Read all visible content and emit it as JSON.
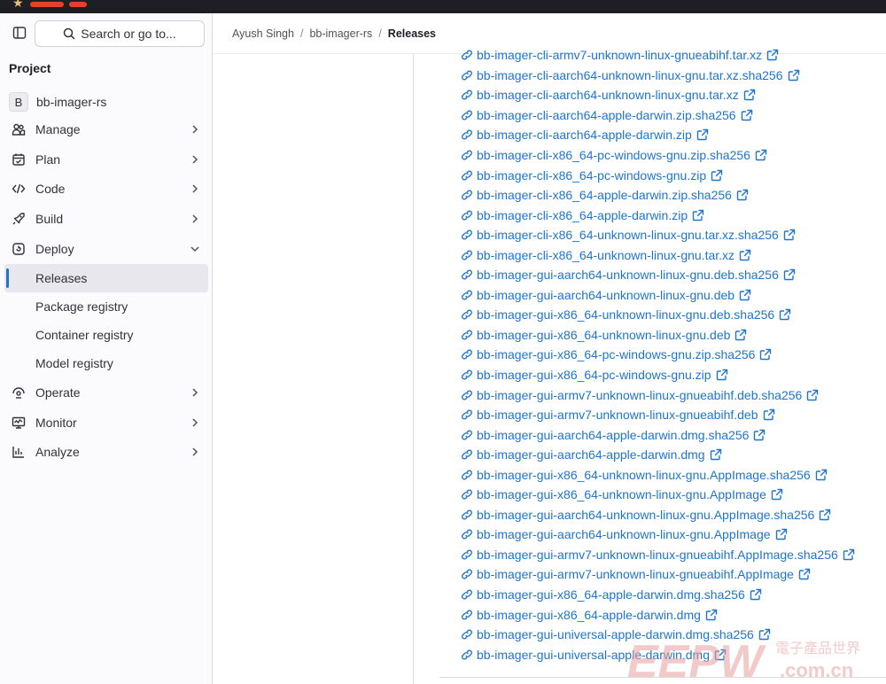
{
  "search": {
    "label": "Search or go to..."
  },
  "sidebar": {
    "section_title": "Project",
    "project": {
      "avatar_letter": "B",
      "name": "bb-imager-rs"
    },
    "items": [
      {
        "label": "Manage",
        "icon": "users-icon"
      },
      {
        "label": "Plan",
        "icon": "calendar-icon"
      },
      {
        "label": "Code",
        "icon": "code-icon"
      },
      {
        "label": "Build",
        "icon": "rocket-icon"
      },
      {
        "label": "Deploy",
        "icon": "deploy-icon"
      }
    ],
    "deploy_sub": [
      {
        "label": "Releases",
        "active": true
      },
      {
        "label": "Package registry"
      },
      {
        "label": "Container registry"
      },
      {
        "label": "Model registry"
      }
    ],
    "items_after": [
      {
        "label": "Operate",
        "icon": "operate-icon"
      },
      {
        "label": "Monitor",
        "icon": "monitor-icon"
      },
      {
        "label": "Analyze",
        "icon": "chart-icon"
      }
    ]
  },
  "breadcrumb": {
    "user": "Ayush Singh",
    "sep1": "/",
    "project": "bb-imager-rs",
    "sep2": "/",
    "current": "Releases"
  },
  "assets": [
    "bb-imager-cli-armv7-unknown-linux-gnueabihf.tar.xz",
    "bb-imager-cli-aarch64-unknown-linux-gnu.tar.xz.sha256",
    "bb-imager-cli-aarch64-unknown-linux-gnu.tar.xz",
    "bb-imager-cli-aarch64-apple-darwin.zip.sha256",
    "bb-imager-cli-aarch64-apple-darwin.zip",
    "bb-imager-cli-x86_64-pc-windows-gnu.zip.sha256",
    "bb-imager-cli-x86_64-pc-windows-gnu.zip",
    "bb-imager-cli-x86_64-apple-darwin.zip.sha256",
    "bb-imager-cli-x86_64-apple-darwin.zip",
    "bb-imager-cli-x86_64-unknown-linux-gnu.tar.xz.sha256",
    "bb-imager-cli-x86_64-unknown-linux-gnu.tar.xz",
    "bb-imager-gui-aarch64-unknown-linux-gnu.deb.sha256",
    "bb-imager-gui-aarch64-unknown-linux-gnu.deb",
    "bb-imager-gui-x86_64-unknown-linux-gnu.deb.sha256",
    "bb-imager-gui-x86_64-unknown-linux-gnu.deb",
    "bb-imager-gui-x86_64-pc-windows-gnu.zip.sha256",
    "bb-imager-gui-x86_64-pc-windows-gnu.zip",
    "bb-imager-gui-armv7-unknown-linux-gnueabihf.deb.sha256",
    "bb-imager-gui-armv7-unknown-linux-gnueabihf.deb",
    "bb-imager-gui-aarch64-apple-darwin.dmg.sha256",
    "bb-imager-gui-aarch64-apple-darwin.dmg",
    "bb-imager-gui-x86_64-unknown-linux-gnu.AppImage.sha256",
    "bb-imager-gui-x86_64-unknown-linux-gnu.AppImage",
    "bb-imager-gui-aarch64-unknown-linux-gnu.AppImage.sha256",
    "bb-imager-gui-aarch64-unknown-linux-gnu.AppImage",
    "bb-imager-gui-armv7-unknown-linux-gnueabihf.AppImage.sha256",
    "bb-imager-gui-armv7-unknown-linux-gnueabihf.AppImage",
    "bb-imager-gui-x86_64-apple-darwin.dmg.sha256",
    "bb-imager-gui-x86_64-apple-darwin.dmg",
    "bb-imager-gui-universal-apple-darwin.dmg.sha256",
    "bb-imager-gui-universal-apple-darwin.dmg"
  ],
  "watermark": {
    "brand": "EEPW",
    "cn": "電子產品世界",
    "domain": ".com.cn"
  },
  "colors": {
    "link": "#1f75cb",
    "active_indicator": "#1f75cb",
    "sidebar_bg": "#fbfafd",
    "topbar_bg": "#1f1e24"
  }
}
